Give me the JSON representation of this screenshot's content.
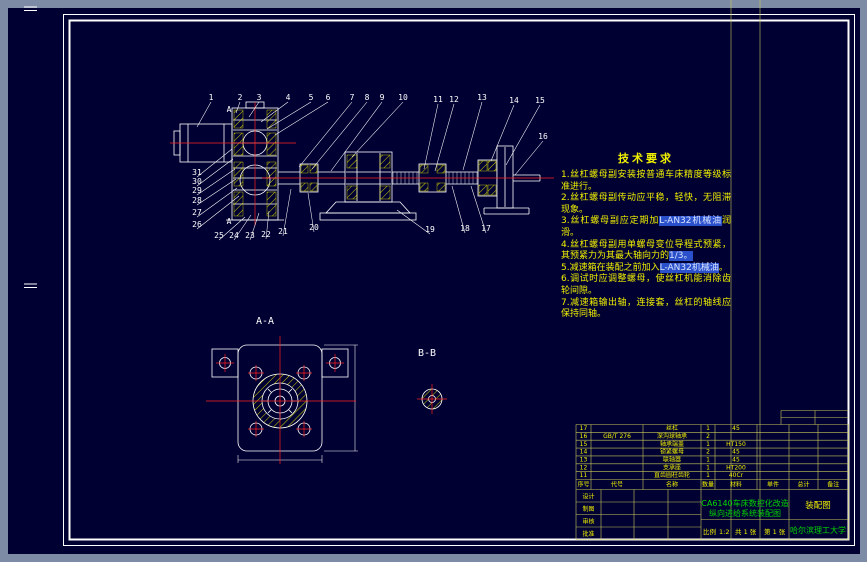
{
  "colors": {
    "background": "#7e8ba4",
    "canvas": "#000033",
    "line_white": "#ffffff",
    "hatch_yellow": "#e8e800",
    "centerline_red": "#ff2020",
    "text_yellow": "#f0f000",
    "text_green": "#00d800",
    "highlight_blue": "#2b50cc"
  },
  "section_labels": {
    "aa": "A-A",
    "bb": "B-B"
  },
  "callouts": {
    "labels": [
      "1",
      "2",
      "3",
      "4",
      "5",
      "6",
      "7",
      "8",
      "9",
      "10",
      "11",
      "12",
      "13",
      "14",
      "15",
      "16",
      "17",
      "18",
      "19",
      "20",
      "21",
      "22",
      "23",
      "24",
      "25",
      "26",
      "27",
      "28",
      "29",
      "30",
      "31",
      "A",
      "A"
    ]
  },
  "tech_requirements": {
    "title": "技术要求",
    "items": [
      [
        {
          "t": "1.丝杠螺母副安装按普通车床精度等级标准进行。"
        }
      ],
      [
        {
          "t": "2.丝杠螺母副传动应平稳，轻快，无阻滞现象。"
        }
      ],
      [
        {
          "t": "3.丝杠螺母副应定期加"
        },
        {
          "t": "L-AN32机械油",
          "hl": true
        },
        {
          "t": "润滑。"
        }
      ],
      [
        {
          "t": "4.丝杠螺母副用单螺母变位导程式预紧，其预紧力为其最大轴向力的"
        },
        {
          "t": "1/3。",
          "hl": true
        }
      ],
      [
        {
          "t": "5.减速箱在装配之前加入"
        },
        {
          "t": "L-AN32机械油",
          "hl": true
        },
        {
          "t": "。"
        }
      ],
      [
        {
          "t": "6.调试时应调整螺母，使丝杠机能消除齿轮间隙。"
        }
      ],
      [
        {
          "t": "7.减速箱输出轴，连接套，丝杠的轴线应保持同轴。"
        }
      ]
    ]
  },
  "parts_list": {
    "headers": [
      "序号",
      "代号",
      "名称",
      "数量",
      "材料",
      "单件",
      "总计",
      "备注"
    ],
    "rows": [
      [
        "17",
        "",
        "丝杠",
        "1",
        "45",
        "",
        "",
        ""
      ],
      [
        "16",
        "GB/T 276",
        "深沟球轴承",
        "2",
        "",
        "",
        "",
        ""
      ],
      [
        "15",
        "",
        "轴承端盖",
        "1",
        "HT150",
        "",
        "",
        ""
      ],
      [
        "14",
        "",
        "锁紧螺母",
        "2",
        "45",
        "",
        "",
        ""
      ],
      [
        "13",
        "",
        "联轴器",
        "1",
        "45",
        "",
        "",
        ""
      ],
      [
        "12",
        "",
        "支承座",
        "1",
        "HT200",
        "",
        "",
        ""
      ],
      [
        "11",
        "",
        "直齿圆柱齿轮",
        "1",
        "40Cr",
        "",
        "",
        ""
      ]
    ]
  },
  "title_block": {
    "sign_labels": [
      "设计",
      "制图",
      "审核",
      "批准"
    ],
    "project_line1": "CA6140车床数控化改造",
    "project_line2": "纵向进给系统装配图",
    "doc_type": "装配图",
    "school": "哈尔滨理工大学",
    "scale_label": "比例",
    "scale_value": "1:2",
    "sheet_total": "共 1 张",
    "sheet_no": "第 1 张"
  }
}
